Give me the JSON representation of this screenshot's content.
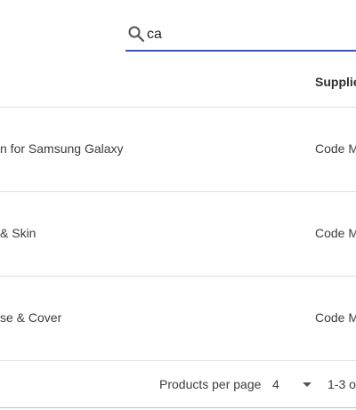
{
  "search": {
    "value": "ca",
    "placeholder": ""
  },
  "table": {
    "columns": {
      "supplier": "Supplie"
    },
    "rows": [
      {
        "name": "n for Samsung Galaxy",
        "supplier": "Code M"
      },
      {
        "name": "& Skin",
        "supplier": "Code M"
      },
      {
        "name": "se & Cover",
        "supplier": "Code M"
      }
    ]
  },
  "pagination": {
    "per_page_label": "Products per page",
    "per_page_value": "4",
    "range_text": "1-3 o"
  },
  "colors": {
    "accent": "#3f51b5",
    "divider": "#e0e0e0"
  },
  "icons": {
    "search": "search-icon",
    "dropdown": "chevron-down-icon"
  }
}
